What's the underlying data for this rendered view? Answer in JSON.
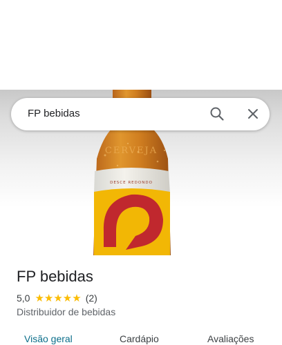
{
  "search": {
    "query": "FP bebidas"
  },
  "place": {
    "name": "FP bebidas",
    "rating": "5,0",
    "stars": "★★★★★",
    "review_count": "(2)",
    "category": "Distribuidor de bebidas"
  },
  "hero_image": {
    "bottle_label_text": "CERVEJA",
    "bottle_band_text": "DESCE REDONDO"
  },
  "tabs": [
    {
      "label": "Visão geral",
      "active": true
    },
    {
      "label": "Cardápio",
      "active": false
    },
    {
      "label": "Avaliações",
      "active": false
    }
  ],
  "colors": {
    "accent": "#0b6e8a",
    "star": "#fbbc04",
    "label_red": "#c0282e",
    "label_yellow": "#f2b705"
  }
}
